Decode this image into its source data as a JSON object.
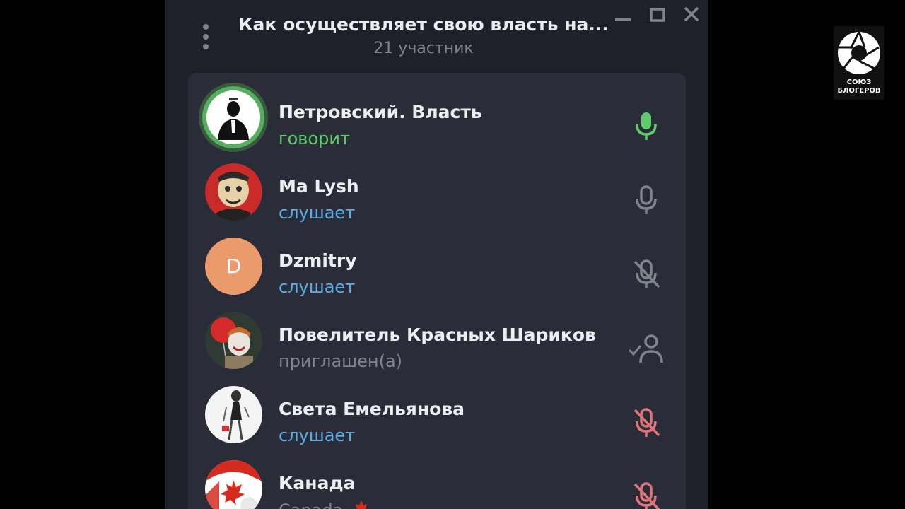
{
  "window": {
    "title": "Как осуществляет свою власть на...",
    "subtitle": "21 участник",
    "controls": {
      "minimize_icon": "minimize-icon",
      "maximize_icon": "maximize-icon",
      "close_icon": "close-icon"
    },
    "menu_icon": "more-vertical-icon"
  },
  "participants": [
    {
      "name": "Петровский. Власть",
      "status": "говорит",
      "status_type": "speaking",
      "mic": "mic-active-icon"
    },
    {
      "name": "Ma Lysh",
      "status": "слушает",
      "status_type": "listening",
      "mic": "mic-icon"
    },
    {
      "name": "Dzmitry",
      "status": "слушает",
      "status_type": "listening",
      "mic": "mic-muted-icon",
      "avatar_letter": "D"
    },
    {
      "name": "Повелитель Красных Шариков",
      "status": "приглашен(а)",
      "status_type": "invited",
      "mic": "user-invited-icon"
    },
    {
      "name": "Света Емельянова",
      "status": "слушает",
      "status_type": "listening",
      "mic": "mic-force-muted-icon"
    },
    {
      "name": "Канада",
      "status": "Canada",
      "status_type": "plain",
      "mic": "mic-force-muted-icon"
    }
  ],
  "watermark": {
    "line1": "СОЮЗ",
    "line2": "БЛОГЕРОВ"
  },
  "colors": {
    "window_bg": "#1e212a",
    "panel_bg": "#2a2d38",
    "speaking": "#5fcc6b",
    "listening": "#5aaee6",
    "muted_by_admin": "#e0747b",
    "icon_gray": "#7e838c",
    "avatar_orange": "#eb9a6b"
  }
}
